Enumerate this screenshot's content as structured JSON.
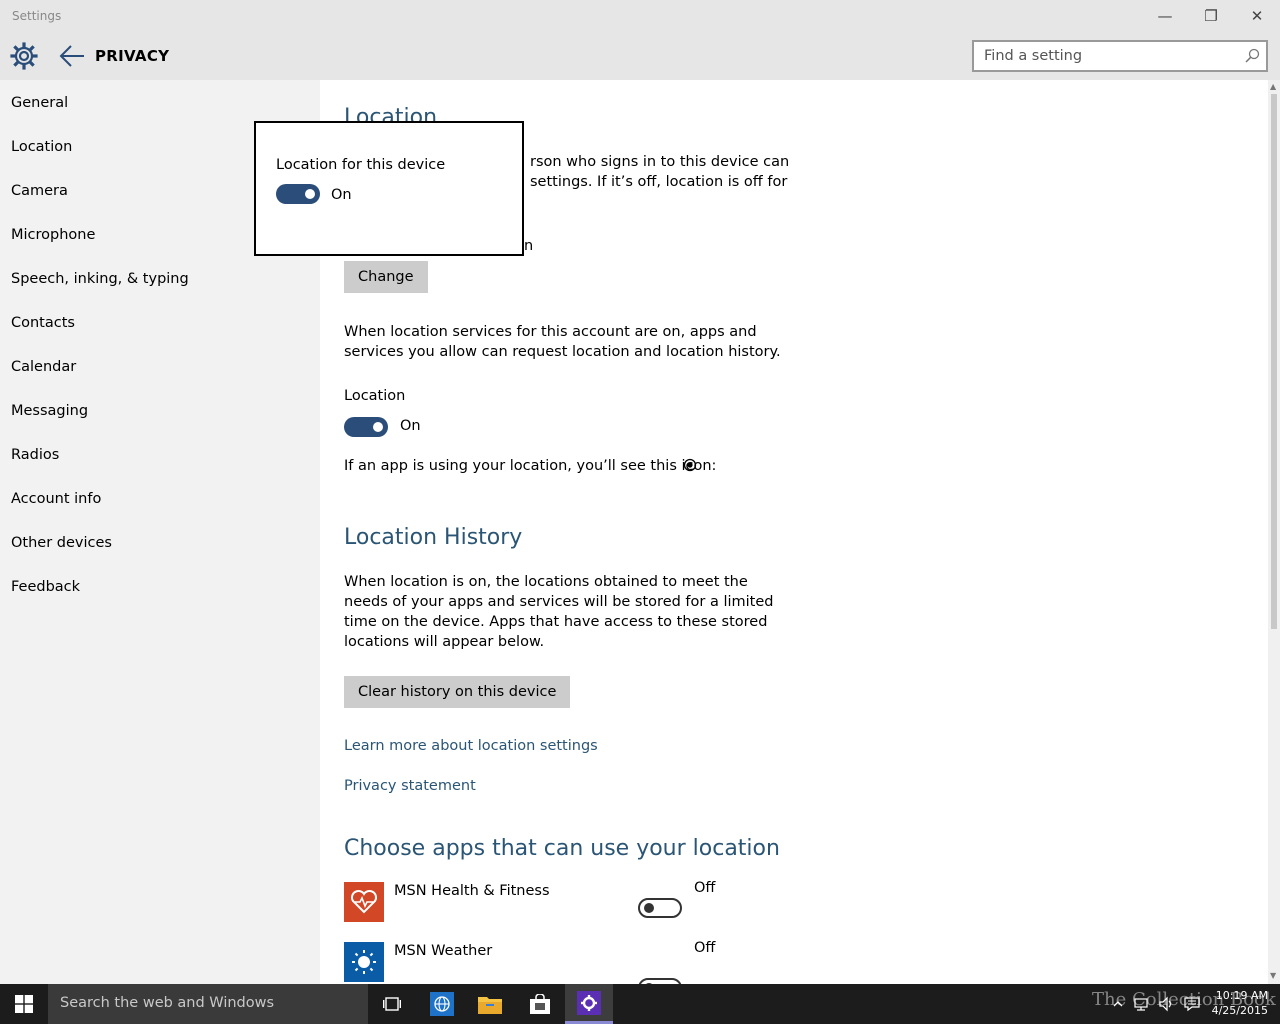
{
  "window": {
    "title": "Settings",
    "minimize_glyph": "—",
    "restore_glyph": "❐",
    "close_glyph": "✕"
  },
  "header": {
    "page_title": "PRIVACY",
    "search_placeholder": "Find a setting"
  },
  "sidebar": {
    "items": [
      {
        "label": "General"
      },
      {
        "label": "Location"
      },
      {
        "label": "Camera"
      },
      {
        "label": "Microphone"
      },
      {
        "label": "Speech, inking, & typing"
      },
      {
        "label": "Contacts"
      },
      {
        "label": "Calendar"
      },
      {
        "label": "Messaging"
      },
      {
        "label": "Radios"
      },
      {
        "label": "Account info"
      },
      {
        "label": "Other devices"
      },
      {
        "label": "Feedback"
      }
    ]
  },
  "main": {
    "section_title": "Location",
    "intro_line1": "rson who signs in to this device can",
    "intro_line2": "settings. If it’s off, location is off for",
    "intro_line3": "n",
    "change_button": "Change",
    "account_text": "When location services for this account are on, apps and services you allow can request location and location history.",
    "location_label": "Location",
    "location_toggle_state": "On",
    "icon_hint": "If an app is using your location, you’ll see this icon:",
    "history_title": "Location History",
    "history_text": "When location is on, the locations obtained to meet the needs of your apps and services will be stored for a limited time on the device. Apps that have access to these stored locations will appear below.",
    "clear_button": "Clear history on this device",
    "learn_more_link": "Learn more about location settings",
    "privacy_link": "Privacy statement",
    "choose_apps_title": "Choose apps that can use your location",
    "apps": [
      {
        "name": "MSN Health & Fitness",
        "state": "Off",
        "icon": "heart-icon",
        "color": "#d24726"
      },
      {
        "name": "MSN Weather",
        "state": "Off",
        "icon": "sun-icon",
        "color": "#0a5ca6"
      }
    ]
  },
  "flyout": {
    "label": "Location for this device",
    "state": "On"
  },
  "taskbar": {
    "search_text": "Search the web and Windows",
    "time": "10:19 AM",
    "date": "4/25/2015",
    "watermark": "The Collection Book"
  },
  "colors": {
    "accent": "#2b5575",
    "toggle_on": "#2b4d7a",
    "sidebar_bg": "#f2f2f2",
    "header_bg": "#e6e6e6",
    "taskbar_bg": "#1c1c1c"
  }
}
